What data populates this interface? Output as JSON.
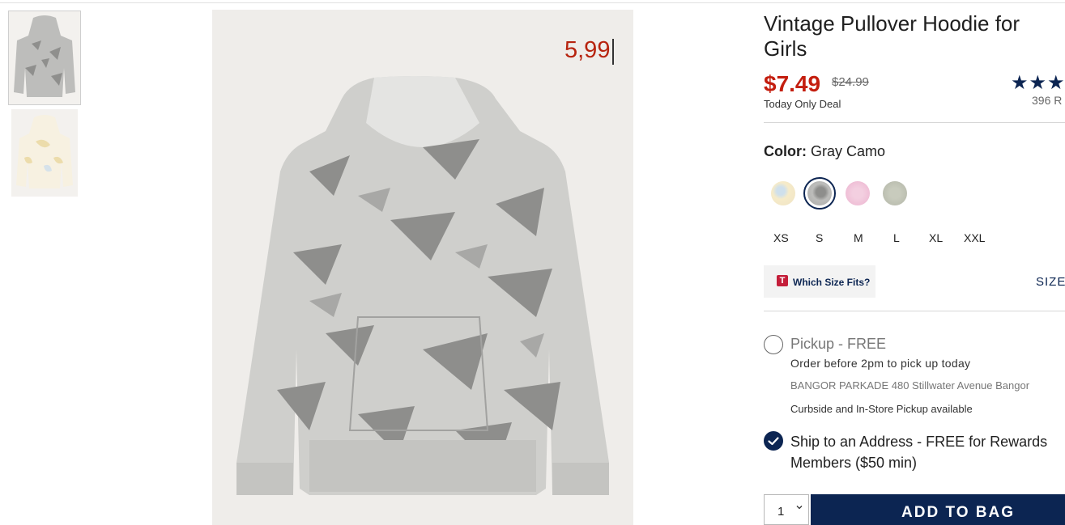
{
  "product": {
    "title": "Vintage Pullover Hoodie for Girls",
    "sale_price": "$7.49",
    "original_price": "$24.99",
    "deal_label": "Today Only Deal",
    "rating_stars": "★★★",
    "reviews": "396 R",
    "price_overlay": "5,99"
  },
  "color": {
    "label": "Color:",
    "selected": "Gray Camo",
    "swatches": [
      {
        "name": "yellow-tie-dye",
        "color": "#efe3c4"
      },
      {
        "name": "gray-camo",
        "color": "#a9a9a6"
      },
      {
        "name": "pink-tie-dye",
        "color": "#ecb3cf"
      },
      {
        "name": "green-camo",
        "color": "#b3b6a8"
      }
    ]
  },
  "sizes": [
    "XS",
    "S",
    "M",
    "L",
    "XL",
    "XXL"
  ],
  "size_help": {
    "badge": "T",
    "label": "Which Size Fits?",
    "chart_link": "SIZE"
  },
  "fulfillment": {
    "pickup_title": "Pickup - FREE",
    "pickup_sub": "Order before 2pm to pick up today",
    "store": "BANGOR PARKADE 480 Stillwater Avenue  Bangor",
    "curbside": "Curbside and In-Store Pickup available",
    "ship_line1": "Ship to an Address - FREE for Rewards",
    "ship_line2": "Members ($50 min)"
  },
  "cart": {
    "quantity": "1",
    "add_label": "ADD TO BAG"
  },
  "colors": {
    "accent": "#0c2552",
    "sale": "#c41e0f"
  }
}
